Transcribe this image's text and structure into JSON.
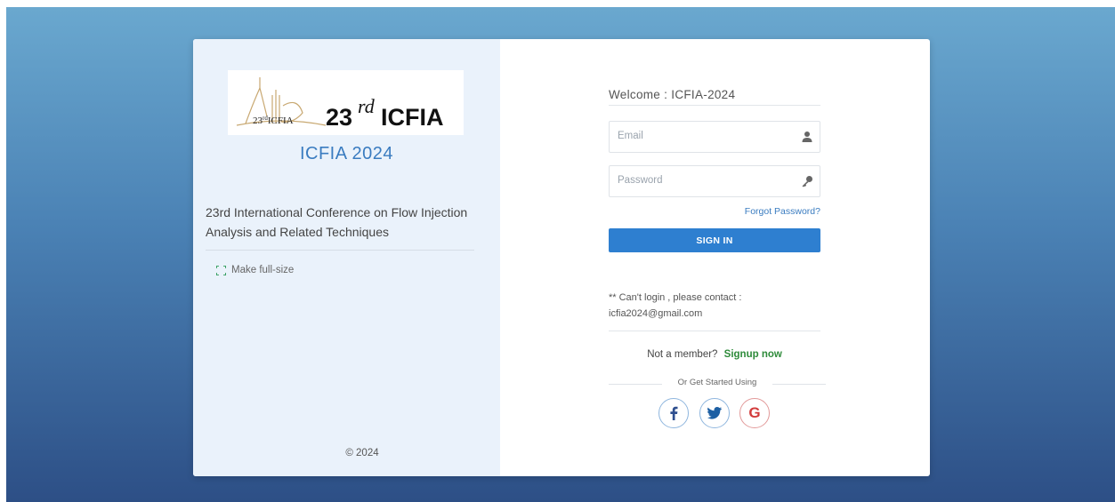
{
  "left_panel": {
    "logo": {
      "small_text": "23rdICFIA",
      "big_text": "23rd ICFIA"
    },
    "title": "ICFIA 2024",
    "description": "23rd International Conference on Flow Injection Analysis and Related Techniques",
    "fullsize_label": "Make full-size",
    "copyright": "© 2024"
  },
  "login": {
    "welcome": "Welcome : ICFIA-2024",
    "email_placeholder": "Email",
    "email_value": "",
    "password_placeholder": "Password",
    "password_value": "",
    "forgot_label": "Forgot Password?",
    "signin_label": "SIGN IN",
    "contact_line1": "** Can't login , please contact :",
    "contact_email": "icfia2024@gmail.com",
    "not_member": "Not a member?",
    "signup_label": "Signup now",
    "or_text": "Or Get Started Using"
  },
  "social": [
    {
      "name": "facebook-icon",
      "glyph": "f",
      "color": "#3b5998"
    },
    {
      "name": "twitter-icon",
      "glyph": "t",
      "color": "#1d6fb0"
    },
    {
      "name": "google-icon",
      "glyph": "G",
      "color": "#d23b3b"
    }
  ]
}
